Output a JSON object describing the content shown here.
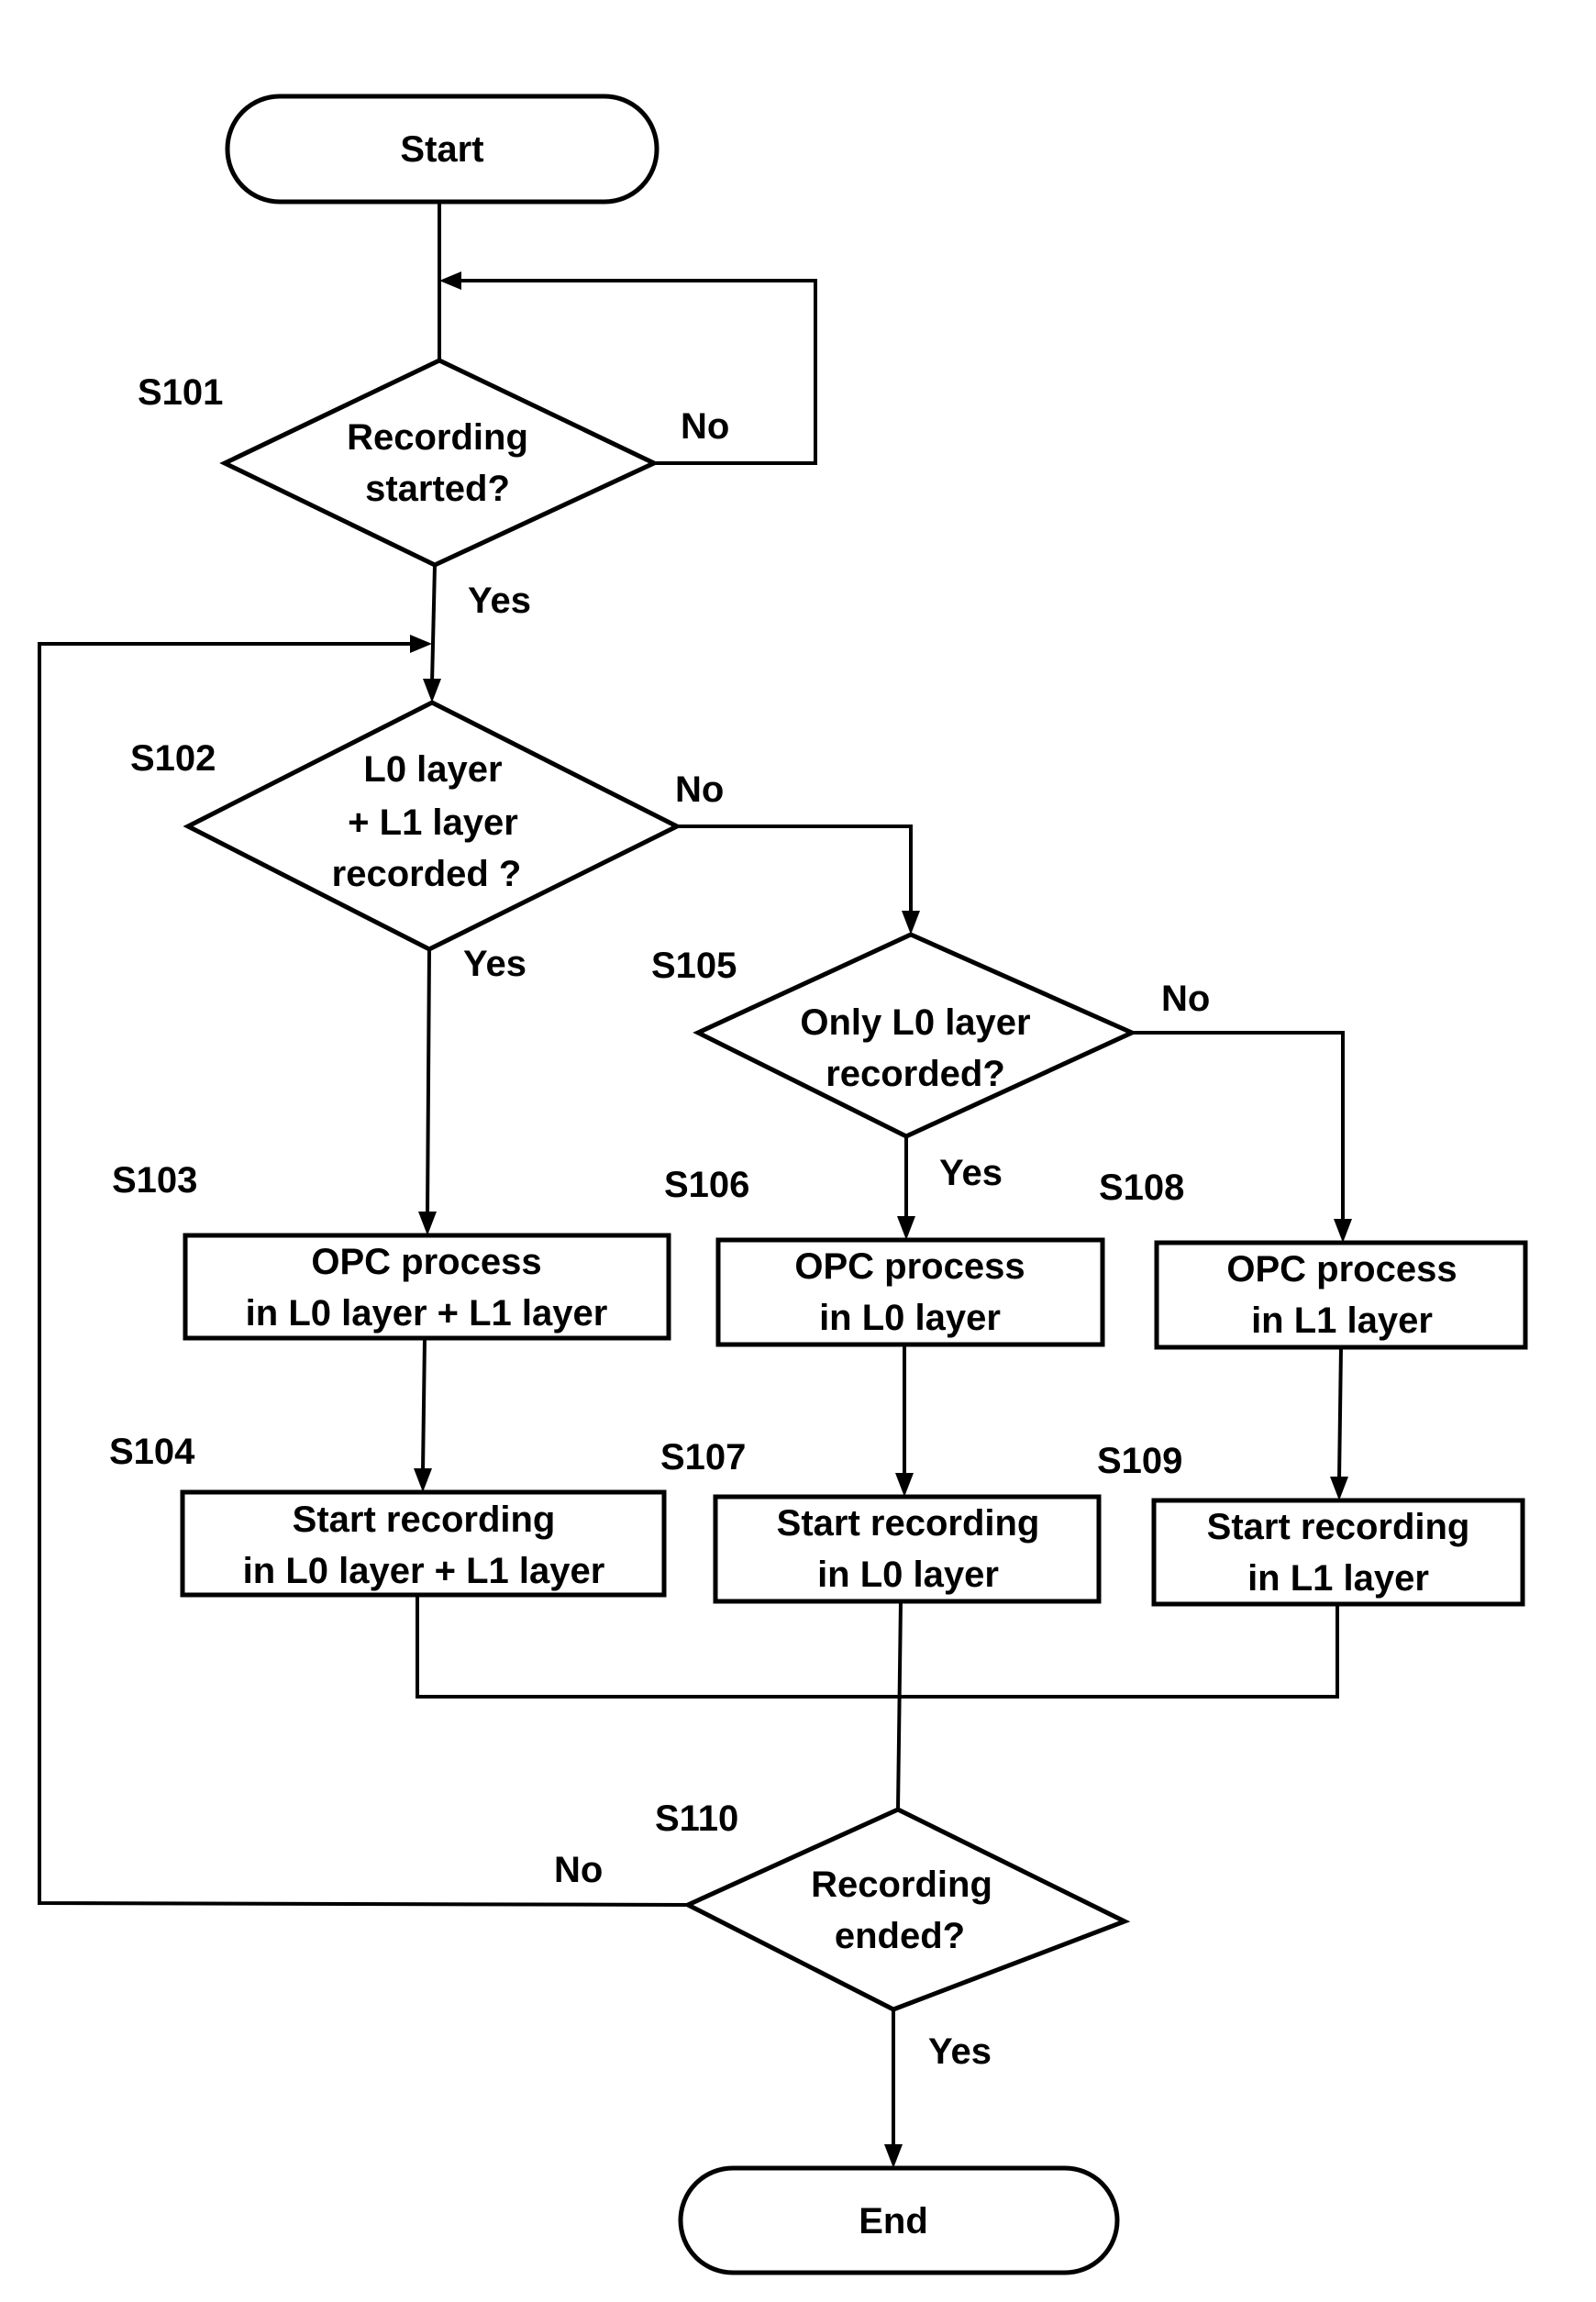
{
  "terminals": {
    "start": {
      "label": "Start"
    },
    "end": {
      "label": "End"
    }
  },
  "decisions": {
    "s101": {
      "step": "S101",
      "lines": [
        "Recording",
        "started?"
      ],
      "yes": "Yes",
      "no": "No"
    },
    "s102": {
      "step": "S102",
      "lines": [
        "L0 layer",
        "+ L1 layer",
        "recorded ?"
      ],
      "yes": "Yes",
      "no": "No"
    },
    "s105": {
      "step": "S105",
      "lines": [
        "Only L0 layer",
        "recorded?"
      ],
      "yes": "Yes",
      "no": "No"
    },
    "s110": {
      "step": "S110",
      "lines": [
        "Recording",
        "ended?"
      ],
      "yes": "Yes",
      "no": "No"
    }
  },
  "processes": {
    "s103": {
      "step": "S103",
      "lines": [
        "OPC process",
        "in L0 layer + L1 layer"
      ]
    },
    "s104": {
      "step": "S104",
      "lines": [
        "Start recording",
        "in L0 layer + L1 layer"
      ]
    },
    "s106": {
      "step": "S106",
      "lines": [
        "OPC process",
        "in L0 layer"
      ]
    },
    "s107": {
      "step": "S107",
      "lines": [
        "Start recording",
        "in L0 layer"
      ]
    },
    "s108": {
      "step": "S108",
      "lines": [
        "OPC process",
        "in L1 layer"
      ]
    },
    "s109": {
      "step": "S109",
      "lines": [
        "Start recording",
        "in  L1 layer"
      ]
    }
  }
}
